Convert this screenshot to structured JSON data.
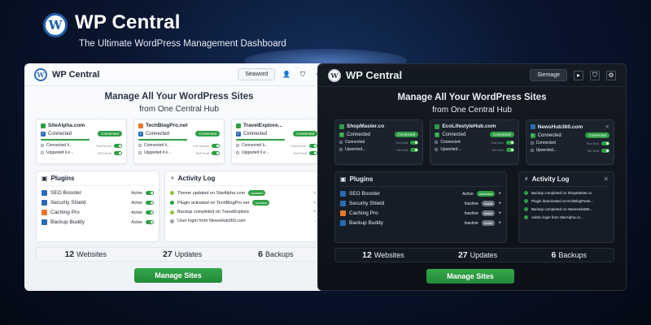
{
  "hero": {
    "title": "WP Central",
    "subtitle": "The Ultimate WordPress Management Dashboard"
  },
  "light": {
    "brand": "WP Central",
    "search": "Seaword",
    "title1": "Manage All Your WordPress Sites",
    "title2": "from One Central Hub",
    "sites": [
      {
        "name": "SiteAlpha.com",
        "status": "Connected",
        "pill": "Connected",
        "row1": "Connected li...",
        "meta1": "TaskFinder",
        "row2": "Upgasted li e...",
        "meta2": "Bdfl Radt"
      },
      {
        "name": "TechBlogPro.net",
        "status": "Connected",
        "pill": "Connected",
        "row1": "Connected li...",
        "meta1": "Ldil Saddle",
        "row2": "Upgasted li e...",
        "meta2": "Bdfl Radt"
      },
      {
        "name": "TravelExplore...",
        "status": "Connected",
        "pill": "Connected",
        "row1": "Connected li...",
        "meta1": "TaskFinder",
        "row2": "Upgasted li e...",
        "meta2": "Bdfl Radt"
      }
    ],
    "plugins_title": "Plugins",
    "plugins": [
      {
        "name": "SEO Booster",
        "state": "Active",
        "color": "#2a6bb5"
      },
      {
        "name": "Security Shield",
        "state": "Active",
        "color": "#2a6bb5"
      },
      {
        "name": "Caching Pro",
        "state": "Active",
        "color": "#e8772e"
      },
      {
        "name": "Backup Buddy",
        "state": "Active",
        "color": "#2a6bb5"
      }
    ],
    "activity_title": "Activity Log",
    "activity": [
      {
        "text": "Theme updated on SiteAlpha.com",
        "pill": "Updated"
      },
      {
        "text": "Plugin activated on TechBlogPro.net",
        "pill": "Updated"
      },
      {
        "text": "Backup completed on TravelExplore",
        "pill": ""
      },
      {
        "text": "User login from NewsHub360.com",
        "pill": ""
      }
    ],
    "stats": [
      {
        "n": "12",
        "label": "Websites"
      },
      {
        "n": "27",
        "label": "Updates"
      },
      {
        "n": "6",
        "label": "Backups"
      }
    ],
    "cta": "Manage Sites"
  },
  "dark": {
    "brand": "WP Central",
    "search": "Siemage",
    "title1": "Manage All Your WordPress Sites",
    "title2": "from One Central Hub",
    "sites": [
      {
        "name": "ShopMaster.co",
        "status": "Connected",
        "pill": "Connected",
        "row1": "Connected",
        "meta1": "Scd Nod",
        "row2": "Upsected...",
        "meta2": "Sbl Nod"
      },
      {
        "name": "EcoLifestyleHub.com",
        "status": "Connected",
        "pill": "Connected",
        "row1": "Connected",
        "meta1": "Scd Nod",
        "row2": "Upsected...",
        "meta2": "Sbl Nod"
      },
      {
        "name": "NewsHub360.com",
        "status": "Connected",
        "pill": "Connected",
        "row1": "Connected",
        "meta1": "Scd Nod",
        "row2": "Upsected...",
        "meta2": "Sbl Nod"
      }
    ],
    "plugins_title": "Plugins",
    "plugins": [
      {
        "name": "SEO Booster",
        "state": "Active",
        "pill": "Activated",
        "color": "#2a6bb5"
      },
      {
        "name": "Security Shield",
        "state": "Inactive",
        "pill": "Install",
        "color": "#2a6bb5"
      },
      {
        "name": "Caching Pro",
        "state": "Inactive",
        "pill": "Install",
        "color": "#e8772e"
      },
      {
        "name": "Backup Buddy",
        "state": "Inactive",
        "pill": "Install",
        "color": "#2a6bb5"
      }
    ],
    "activity_title": "Activity Log",
    "activity": [
      {
        "text": "Backup completed on ShopMaster.co"
      },
      {
        "text": "Plugin deactivated on EchBlogPaste..."
      },
      {
        "text": "Backup completed on NewsHub360..."
      },
      {
        "text": "Admin login from SiteAlpha.co..."
      }
    ],
    "stats": [
      {
        "n": "12",
        "label": "Websites"
      },
      {
        "n": "27",
        "label": "Updates"
      },
      {
        "n": "6",
        "label": "Backups"
      }
    ],
    "cta": "Manage Sites"
  }
}
